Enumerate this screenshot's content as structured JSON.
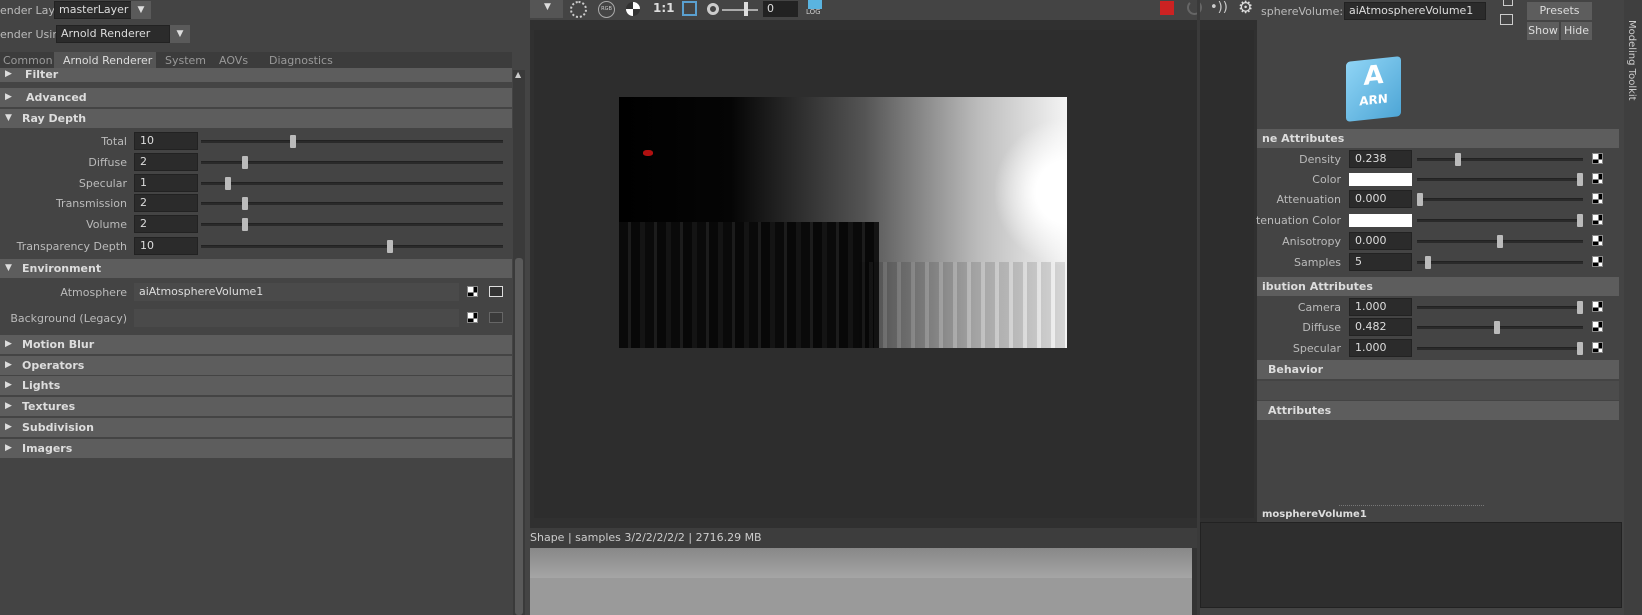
{
  "left": {
    "render_layer_label": "ender Layer",
    "render_layer_value": "masterLayer",
    "render_using_label": "ender Using",
    "render_using_value": "Arnold Renderer",
    "tabs": [
      "Common",
      "Arnold Renderer",
      "System",
      "AOVs",
      "Diagnostics"
    ],
    "sections_top": [
      "Filter",
      "Advanced",
      "Ray Depth"
    ],
    "ray_depth": [
      {
        "label": "Total",
        "value": "10",
        "fraction": 0.3
      },
      {
        "label": "Diffuse",
        "value": "2",
        "fraction": 0.14
      },
      {
        "label": "Specular",
        "value": "1",
        "fraction": 0.08
      },
      {
        "label": "Transmission",
        "value": "2",
        "fraction": 0.14
      },
      {
        "label": "Volume",
        "value": "2",
        "fraction": 0.14
      },
      {
        "label": "Transparency Depth",
        "value": "10",
        "fraction": 0.63
      }
    ],
    "environment": {
      "title": "Environment",
      "atmosphere_label": "Atmosphere",
      "atmosphere_value": "aiAtmosphereVolume1",
      "background_label": "Background (Legacy)",
      "background_value": ""
    },
    "sections_bottom": [
      "Motion Blur",
      "Operators",
      "Lights",
      "Textures",
      "Subdivision",
      "Imagers"
    ]
  },
  "render_view": {
    "ratio_label": "1:1",
    "exposure_value": "0",
    "log_label": "LOG",
    "status_text": "Shape  | samples 3/2/2/2/2/2 | 2716.29 MB"
  },
  "right": {
    "node_label": "sphereVolume:",
    "node_value": "aiAtmosphereVolume1",
    "presets_label": "Presets",
    "show_label": "Show",
    "hide_label": "Hide",
    "logo_letter": "A",
    "logo_text": "ARN",
    "side_tab": "Modeling Toolkit",
    "volume_section": "ne Attributes",
    "volume_attrs": [
      {
        "label": "Density",
        "value": "0.238",
        "fraction": 0.24
      },
      {
        "label": "Color",
        "value": "",
        "fraction": 1.0,
        "swatch": true
      },
      {
        "label": "Attenuation",
        "value": "0.000",
        "fraction": 0.0
      },
      {
        "label": "tenuation Color",
        "value": "",
        "fraction": 1.0,
        "swatch": true
      },
      {
        "label": "Anisotropy",
        "value": "0.000",
        "fraction": 0.5
      },
      {
        "label": "Samples",
        "value": "5",
        "fraction": 0.05
      }
    ],
    "contrib_section": "ibution Attributes",
    "contrib_attrs": [
      {
        "label": "Camera",
        "value": "1.000",
        "fraction": 1.0
      },
      {
        "label": "Diffuse",
        "value": "0.482",
        "fraction": 0.48
      },
      {
        "label": "Specular",
        "value": "1.000",
        "fraction": 1.0
      }
    ],
    "behavior_section": "Behavior",
    "extra_section": "Attributes",
    "footer_label": "mosphereVolume1"
  },
  "colors": {
    "panel": "#444444",
    "section": "#5d5d5d",
    "field": "#2b2b2b",
    "stop_red": "#cc2222",
    "logo_blue": "#5ab4e0"
  }
}
